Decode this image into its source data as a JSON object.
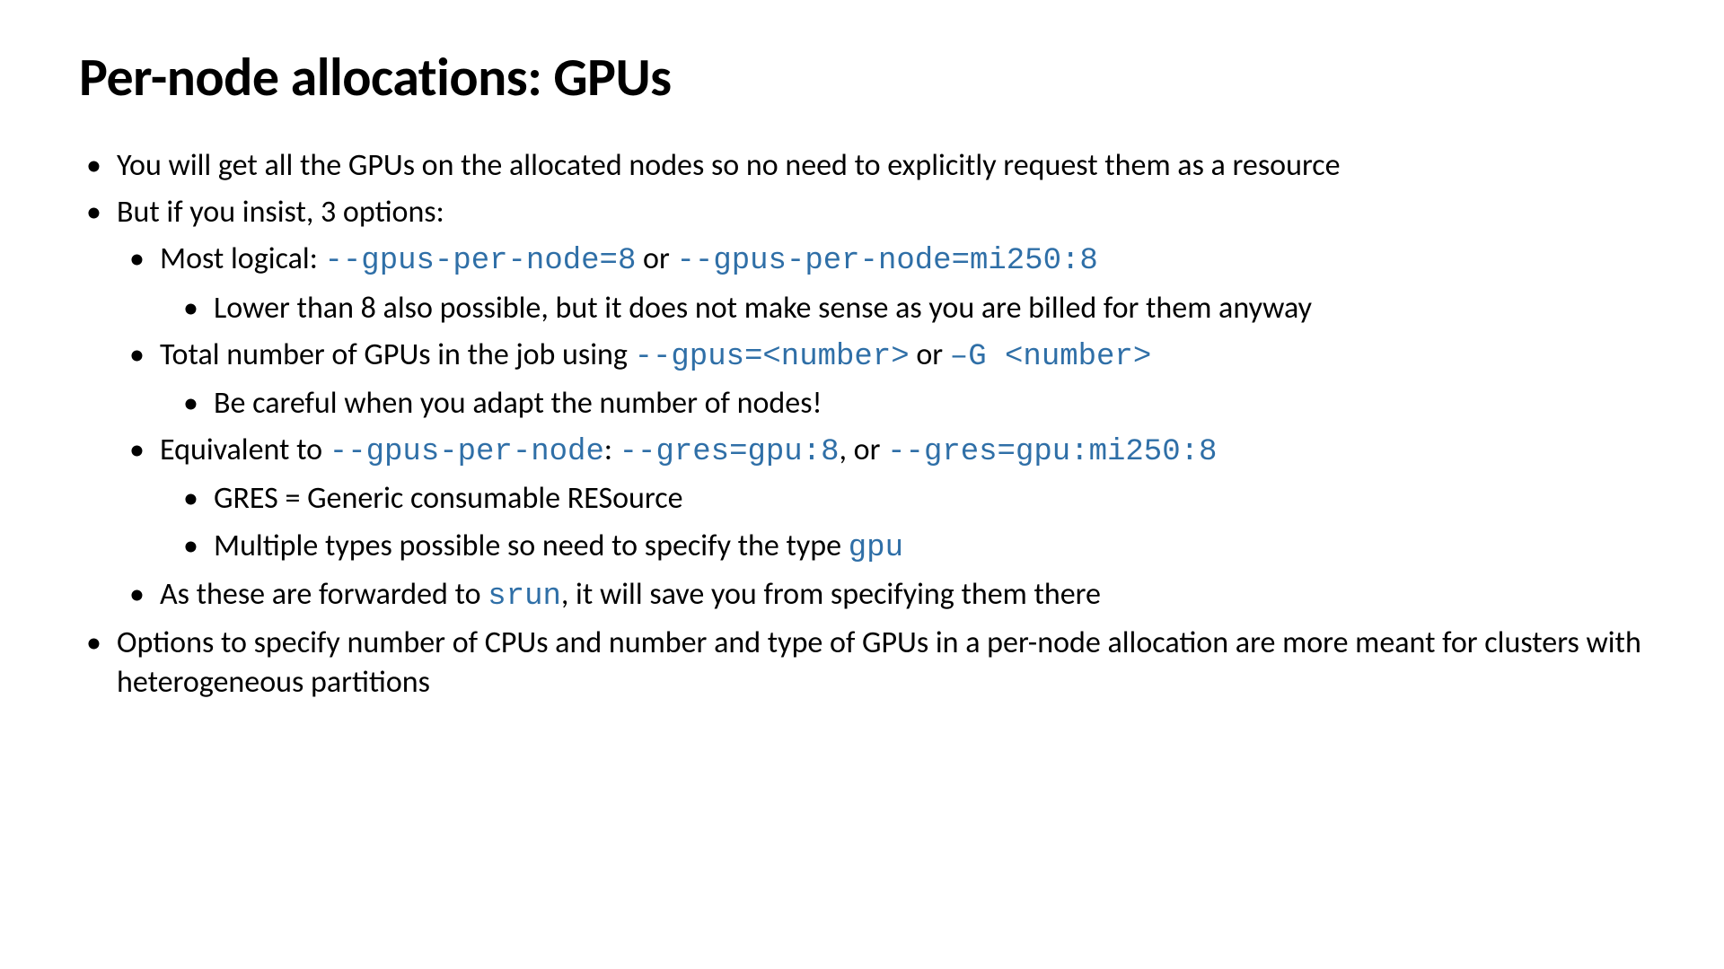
{
  "title": "Per-node allocations: GPUs",
  "b1": "You will get all the GPUs on the allocated nodes so no need to explicitly request them as a resource",
  "b2": "But if you insist, 3 options:",
  "b2a_pre": "Most logical: ",
  "b2a_code1": "--gpus-per-node=8",
  "b2a_mid": " or ",
  "b2a_code2": "--gpus-per-node=mi250:8",
  "b2a_i": "Lower than 8 also possible, but it does not make sense as you are billed for them anyway",
  "b2b_pre": "Total number of GPUs in the job using ",
  "b2b_code1": "--gpus=<number>",
  "b2b_mid": " or ",
  "b2b_code2": "–G <number>",
  "b2b_i": "Be careful when you adapt the number of nodes!",
  "b2c_pre": "Equivalent to ",
  "b2c_code1": "--gpus-per-node",
  "b2c_mid1": ": ",
  "b2c_code2": "--gres=gpu:8",
  "b2c_mid2": ", or ",
  "b2c_code3": "--gres=gpu:mi250:8",
  "b2c_i1": "GRES = Generic consumable RESource",
  "b2c_i2_pre": "Multiple types possible so need to specify the type ",
  "b2c_i2_code": "gpu",
  "b2d_pre": "As these are forwarded to ",
  "b2d_code": "srun",
  "b2d_post": ", it will save you from specifying them there",
  "b3": "Options to specify number of CPUs and number and type of GPUs in a per-node allocation are more meant for clusters with heterogeneous partitions"
}
